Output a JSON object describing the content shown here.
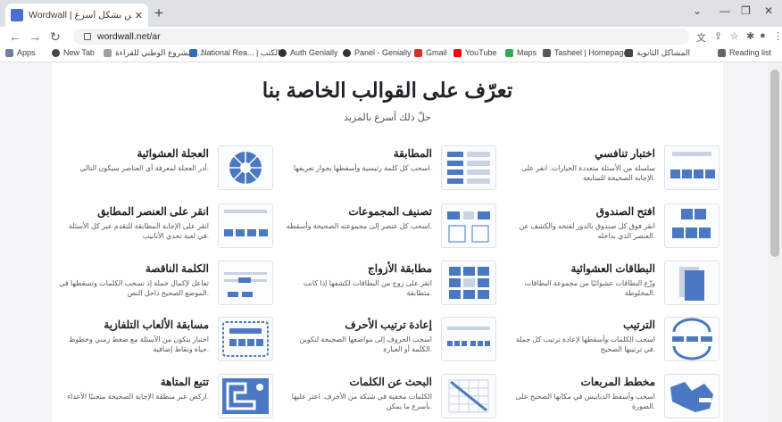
{
  "browser": {
    "tab_title": "Wordwall | إنشاء أفضل الدروس بشكل أسرع",
    "url": "wordwall.net/ar",
    "bookmarks": [
      "Apps",
      "New Tab",
      "المشروع الوطني للقراءة...",
      "National Rea... | الكتب",
      "Auth Genially",
      "Panel - Genially",
      "Gmail",
      "YouTube",
      "Maps",
      "Tasheel | Homepage",
      "المشاكل الثانوية",
      "Reading list"
    ]
  },
  "page": {
    "heading": "تعرّف على القوالب الخاصة بنا",
    "subheading": "حلّ ذلك أسرع بالمزيد"
  },
  "templates": [
    {
      "title": "اختبار تنافسي",
      "desc": "سلسلة من الأسئلة متعددة الخيارات. انقر على الإجابة الصحيحة للمتابعة."
    },
    {
      "title": "المطابقة",
      "desc": "اسحب كل كلمة رئيسية وأسقطها بجوار تعريفها."
    },
    {
      "title": "العجلة العشوائية",
      "desc": "أدر العجلة لمعرفة أي العناصر سيكون التالي."
    },
    {
      "title": "افتح الصندوق",
      "desc": "انقر فوق كل صندوق بالدور لفتحه والكشف عن العنصر الذي بداخله."
    },
    {
      "title": "تصنيف المجموعات",
      "desc": "اسحب كل عنصر إلى مجموعته الصحيحة وأسقطه."
    },
    {
      "title": "انقر على العنصر المطابق",
      "desc": "انقر على الإجابة المطابقة للتقدم عبر كل الأسئلة في لعبة تحدي الأنابيب."
    },
    {
      "title": "البطاقات العشوائية",
      "desc": "وزّع البطاقات عشوائيًا من مجموعة البطاقات المخلوطة."
    },
    {
      "title": "مطابقة الأزواج",
      "desc": "انقر على زوج من البطاقات لكشفها إذا كانت متطابقة."
    },
    {
      "title": "الكلمة الناقصة",
      "desc": "تفاعل لإكمال جملة إذ تسحب الكلمات وتسقطها في الموضع الصحيح داخل النص."
    },
    {
      "title": "الترتيب",
      "desc": "اسحب الكلمات وأسقطها لإعادة ترتيب كل جملة في ترتيبها الصحيح."
    },
    {
      "title": "إعادة ترتيب الأحرف",
      "desc": "اسحب الحروف إلى مواضعها الصحيحة لتكوين الكلمة أو العبارة."
    },
    {
      "title": "مسابقة الألعاب التلفازية",
      "desc": "اختبار يتكون من الأسئلة مع ضغط زمني وخطوط حياة ونقاط إضافية."
    },
    {
      "title": "مخطط المربعات",
      "desc": "اسحب وأسقط الدبابيس في مكانها الصحيح على الصورة."
    },
    {
      "title": "البحث عن الكلمات",
      "desc": "الكلمات مخفية في شبكة من الأحرف. اعثر عليها بأسرع ما يمكن."
    },
    {
      "title": "تتبع المتاهة",
      "desc": "اركض عبر منطقة الإجابة الصحيحة متجنبًا الأعداء."
    }
  ],
  "colors": {
    "accent": "#4a78c2",
    "tab_bar": "#dee1e6"
  }
}
